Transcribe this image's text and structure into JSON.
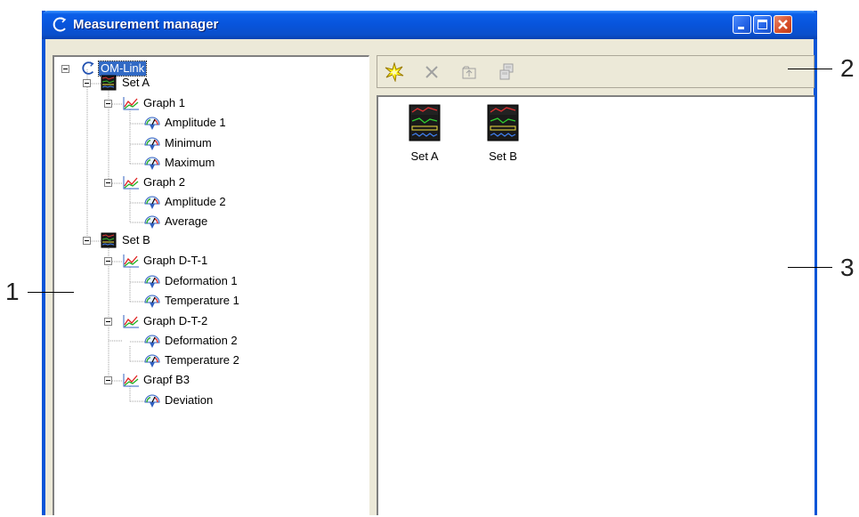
{
  "window": {
    "title": "Measurement manager"
  },
  "tree": {
    "items": [
      {
        "label": "OM-Link",
        "icon": "om-link-icon",
        "level": 0,
        "selected": true
      },
      {
        "label": "Set A",
        "icon": "set-icon",
        "level": 1
      },
      {
        "label": "Graph 1",
        "icon": "graph-icon",
        "level": 2
      },
      {
        "label": "Amplitude 1",
        "icon": "gauge-icon",
        "level": 3
      },
      {
        "label": "Minimum",
        "icon": "gauge-icon",
        "level": 3
      },
      {
        "label": "Maximum",
        "icon": "gauge-icon",
        "level": 3
      },
      {
        "label": "Graph 2",
        "icon": "graph-icon",
        "level": 2
      },
      {
        "label": "Amplitude 2",
        "icon": "gauge-icon",
        "level": 3
      },
      {
        "label": "Average",
        "icon": "gauge-icon",
        "level": 3
      },
      {
        "label": "Set B",
        "icon": "set-icon",
        "level": 1
      },
      {
        "label": "Graph D-T-1",
        "icon": "graph-icon",
        "level": 2
      },
      {
        "label": "Deformation 1",
        "icon": "gauge-icon",
        "level": 3
      },
      {
        "label": "Temperature 1",
        "icon": "gauge-icon",
        "level": 3
      },
      {
        "label": "Graph D-T-2",
        "icon": "graph-icon",
        "level": 2
      },
      {
        "label": "Deformation 2",
        "icon": "gauge-icon",
        "level": 3
      },
      {
        "label": "Temperature 2",
        "icon": "gauge-icon",
        "level": 3
      },
      {
        "label": "Grapf B3",
        "icon": "graph-icon",
        "level": 2
      },
      {
        "label": "Deviation",
        "icon": "gauge-icon",
        "level": 3
      }
    ]
  },
  "toolbar": {
    "buttons": [
      {
        "icon": "new-star-icon",
        "enabled": true
      },
      {
        "icon": "delete-x-icon",
        "enabled": false
      },
      {
        "icon": "up-folder-icon",
        "enabled": false
      },
      {
        "icon": "properties-icon",
        "enabled": false
      }
    ]
  },
  "content": {
    "items": [
      {
        "label": "Set A",
        "icon": "set-icon"
      },
      {
        "label": "Set B",
        "icon": "set-icon"
      }
    ]
  },
  "callouts": {
    "one": "1",
    "two": "2",
    "three": "3"
  },
  "colors": {
    "title_bar": "#0A5FE9",
    "selection": "#316AC5",
    "window_face": "#ECE9D8"
  }
}
